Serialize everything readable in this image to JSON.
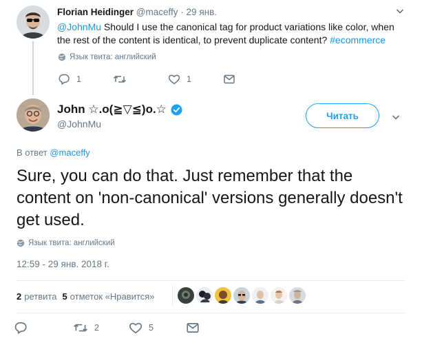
{
  "parent_tweet": {
    "author_name": "Florian Heidinger",
    "author_handle": "@maceffy",
    "separator": "·",
    "time": "29 янв.",
    "mention": "@JohnMu",
    "text_body": " Should I use the canonical tag for product variations like color, when the rest of the content is identical, to prevent duplicate content? ",
    "hashtag": "#ecommerce",
    "language": "Язык твита: английский",
    "actions": {
      "reply_count": "1",
      "retweet_count": "",
      "like_count": "1",
      "message_count": ""
    }
  },
  "main_tweet": {
    "author_name": "John ☆.o(≧▽≦)o.☆",
    "author_handle": "@JohnMu",
    "follow_label": "Читать",
    "reply_prefix": "В ответ",
    "reply_to_handle": "@maceffy",
    "text": "Sure, you can do that. Just remember that the content on 'non-canonical' versions generally doesn't get used.",
    "language": "Язык твита: английский",
    "timestamp": "12:59 - 29 янв. 2018 г.",
    "stats": {
      "retweets_count": "2",
      "retweets_label": "ретвита",
      "likes_count": "5",
      "likes_label": "отметок «Нравится»"
    },
    "liker_avatars": [
      "liker-1",
      "liker-2",
      "liker-3",
      "liker-4",
      "liker-5",
      "liker-6",
      "liker-7"
    ],
    "actions": {
      "reply_count": "",
      "retweet_count": "2",
      "like_count": "5",
      "message_count": ""
    }
  },
  "colors": {
    "link": "#1b95e0",
    "accent": "#1da1f2",
    "muted": "#657786",
    "text": "#14171a",
    "border": "#e6ecf0",
    "verified": "#1da1f2"
  },
  "icons": [
    "reply-icon",
    "retweet-icon",
    "like-icon",
    "message-icon",
    "globe-icon",
    "verified-badge-icon",
    "chevron-down-icon"
  ]
}
